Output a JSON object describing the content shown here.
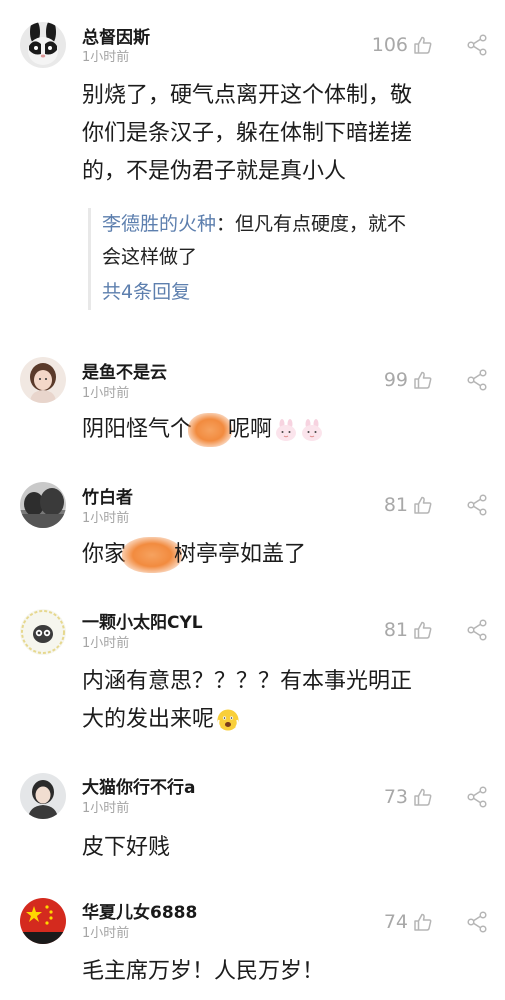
{
  "comments": [
    {
      "username": "总督因斯",
      "time": "1小时前",
      "likes": "106",
      "text_lines": [
        "别烧了，硬气点离开这个体制，敬",
        "你们是条汉子，躲在体制下暗搓搓",
        "的，不是伪君子就是真小人"
      ],
      "reply": {
        "user": "李德胜的火种",
        "text_first": "：但凡有点硬度，就不",
        "text_second": "会这样做了",
        "more": "共4条回复"
      }
    },
    {
      "username": "是鱼不是云",
      "time": "1小时前",
      "likes": "99",
      "text_before": "阴阳怪气个",
      "text_after": "呢啊"
    },
    {
      "username": "竹白者",
      "time": "1小时前",
      "likes": "81",
      "text_before": "你家",
      "text_after": "树亭亭如盖了"
    },
    {
      "username": "一颗小太阳CYL",
      "time": "1小时前",
      "likes": "81",
      "text_lines": [
        "内涵有意思？？？？有本事光明正"
      ],
      "text_last": "大的发出来呢"
    },
    {
      "username": "大猫你行不行a",
      "time": "1小时前",
      "likes": "73",
      "text_lines": [
        "皮下好贱"
      ]
    },
    {
      "username": "华夏儿女6888",
      "time": "1小时前",
      "likes": "74",
      "text_lines": [
        "毛主席万岁！人民万岁！"
      ]
    }
  ]
}
